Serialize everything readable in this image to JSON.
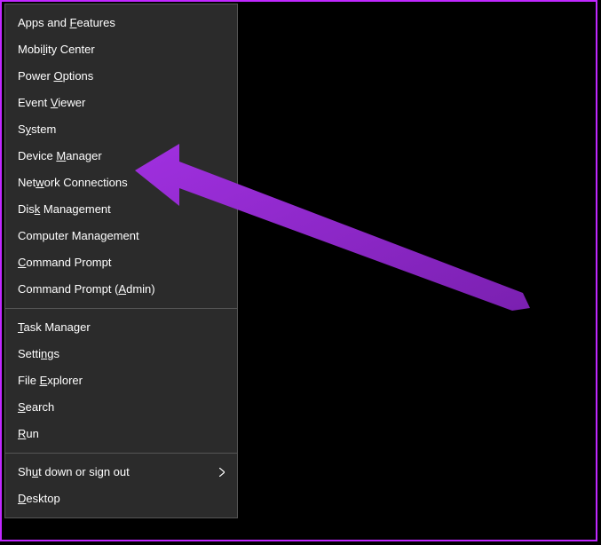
{
  "accent_color": "#9b2fd1",
  "arrow_target": "device-manager",
  "menu": {
    "groups": [
      [
        {
          "id": "apps-and-features",
          "pre": "Apps and ",
          "accel": "F",
          "post": "eatures"
        },
        {
          "id": "mobility-center",
          "pre": "Mobi",
          "accel": "l",
          "post": "ity Center"
        },
        {
          "id": "power-options",
          "pre": "Power ",
          "accel": "O",
          "post": "ptions"
        },
        {
          "id": "event-viewer",
          "pre": "Event ",
          "accel": "V",
          "post": "iewer"
        },
        {
          "id": "system",
          "pre": "S",
          "accel": "y",
          "post": "stem"
        },
        {
          "id": "device-manager",
          "pre": "Device ",
          "accel": "M",
          "post": "anager"
        },
        {
          "id": "network-connections",
          "pre": "Net",
          "accel": "w",
          "post": "ork Connections"
        },
        {
          "id": "disk-management",
          "pre": "Dis",
          "accel": "k",
          "post": " Management"
        },
        {
          "id": "computer-management",
          "pre": "Computer Mana",
          "accel": "g",
          "post": "ement"
        },
        {
          "id": "command-prompt",
          "pre": "",
          "accel": "C",
          "post": "ommand Prompt"
        },
        {
          "id": "command-prompt-admin",
          "pre": "Command Prompt (",
          "accel": "A",
          "post": "dmin)"
        }
      ],
      [
        {
          "id": "task-manager",
          "pre": "",
          "accel": "T",
          "post": "ask Manager"
        },
        {
          "id": "settings",
          "pre": "Setti",
          "accel": "n",
          "post": "gs"
        },
        {
          "id": "file-explorer",
          "pre": "File ",
          "accel": "E",
          "post": "xplorer"
        },
        {
          "id": "search",
          "pre": "",
          "accel": "S",
          "post": "earch"
        },
        {
          "id": "run",
          "pre": "",
          "accel": "R",
          "post": "un"
        }
      ],
      [
        {
          "id": "shut-down-or-sign-out",
          "pre": "Sh",
          "accel": "u",
          "post": "t down or sign out",
          "submenu": true
        },
        {
          "id": "desktop",
          "pre": "",
          "accel": "D",
          "post": "esktop"
        }
      ]
    ]
  }
}
